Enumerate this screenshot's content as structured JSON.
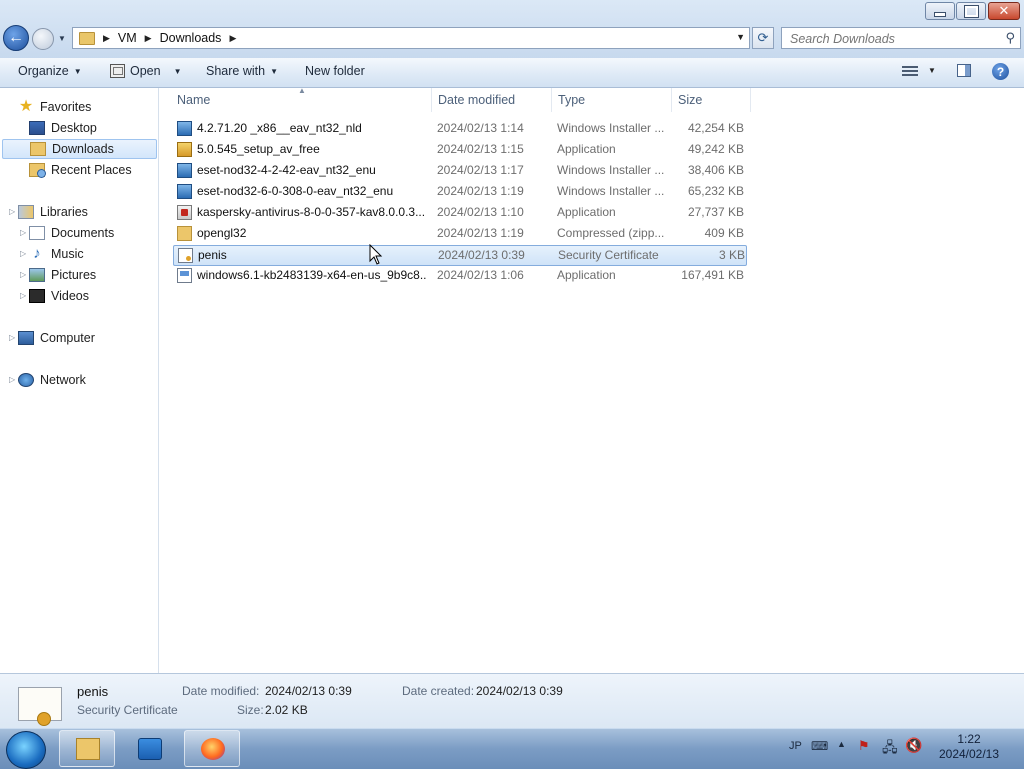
{
  "window": {
    "address": {
      "crumbs": [
        "VM",
        "Downloads"
      ]
    },
    "search": {
      "placeholder": "Search Downloads"
    }
  },
  "toolbar": {
    "organize": "Organize",
    "open": "Open",
    "share_with": "Share with",
    "new_folder": "New folder"
  },
  "nav": {
    "favorites": "Favorites",
    "desktop": "Desktop",
    "downloads": "Downloads",
    "recent_places": "Recent Places",
    "libraries": "Libraries",
    "documents": "Documents",
    "music": "Music",
    "pictures": "Pictures",
    "videos": "Videos",
    "computer": "Computer",
    "network": "Network"
  },
  "columns": {
    "name": "Name",
    "date": "Date modified",
    "type": "Type",
    "size": "Size"
  },
  "files": [
    {
      "name": "4.2.71.20 _x86__eav_nt32_nld",
      "date": "2024/02/13 1:14",
      "type": "Windows Installer ...",
      "size": "42,254 KB",
      "icon": "msi-icon"
    },
    {
      "name": "5.0.545_setup_av_free",
      "date": "2024/02/13 1:15",
      "type": "Application",
      "size": "49,242 KB",
      "icon": "app-icon"
    },
    {
      "name": "eset-nod32-4-2-42-eav_nt32_enu",
      "date": "2024/02/13 1:17",
      "type": "Windows Installer ...",
      "size": "38,406 KB",
      "icon": "msi-icon"
    },
    {
      "name": "eset-nod32-6-0-308-0-eav_nt32_enu",
      "date": "2024/02/13 1:19",
      "type": "Windows Installer ...",
      "size": "65,232 KB",
      "icon": "msi-icon"
    },
    {
      "name": "kaspersky-antivirus-8-0-0-357-kav8.0.0.3...",
      "date": "2024/02/13 1:10",
      "type": "Application",
      "size": "27,737 KB",
      "icon": "kaspersky-icon"
    },
    {
      "name": "opengl32",
      "date": "2024/02/13 1:19",
      "type": "Compressed (zipp...",
      "size": "409 KB",
      "icon": "zip-folder-icon"
    },
    {
      "name": "penis",
      "date": "2024/02/13 0:39",
      "type": "Security Certificate",
      "size": "3 KB",
      "icon": "certificate-icon"
    },
    {
      "name": "windows6.1-kb2483139-x64-en-us_9b9c8...",
      "date": "2024/02/13 1:06",
      "type": "Application",
      "size": "167,491 KB",
      "icon": "window-app-icon"
    }
  ],
  "details": {
    "name": "penis",
    "type": "Security Certificate",
    "modified_label": "Date modified:",
    "modified_value": "2024/02/13 0:39",
    "created_label": "Date created:",
    "created_value": "2024/02/13 0:39",
    "size_label": "Size:",
    "size_value": "2.02 KB"
  },
  "taskbar": {
    "lang": "JP",
    "time": "1:22",
    "date": "2024/02/13"
  }
}
